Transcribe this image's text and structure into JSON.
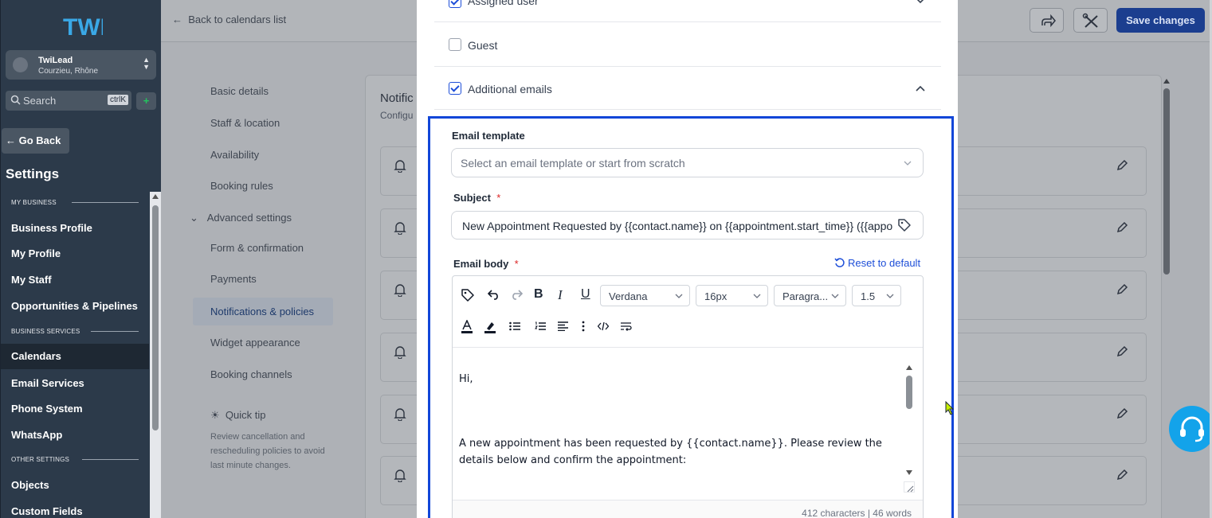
{
  "sidebar": {
    "logo_text": "TWI",
    "account": {
      "name": "TwiLead",
      "location": "Courzieu, Rhône"
    },
    "search": {
      "placeholder": "Search",
      "shortcut": "ctrlK"
    },
    "go_back": "Go Back",
    "title": "Settings",
    "sections": {
      "my_business": "MY BUSINESS",
      "business_services": "BUSINESS SERVICES",
      "other_settings": "OTHER SETTINGS"
    },
    "items": {
      "business_profile": "Business Profile",
      "my_profile": "My Profile",
      "my_staff": "My Staff",
      "opportunities": "Opportunities & Pipelines",
      "calendars": "Calendars",
      "email_services": "Email Services",
      "phone_system": "Phone System",
      "whatsapp": "WhatsApp",
      "objects": "Objects",
      "custom_fields": "Custom Fields"
    }
  },
  "topbar": {
    "back": "Back to calendars list",
    "save": "Save changes"
  },
  "subnav": {
    "basic": "Basic details",
    "staff": "Staff & location",
    "availability": "Availability",
    "booking_rules": "Booking rules",
    "advanced": "Advanced settings",
    "form": "Form & confirmation",
    "payments": "Payments",
    "notifications": "Notifications & policies",
    "widget": "Widget appearance",
    "channels": "Booking channels"
  },
  "quick_tip": {
    "title": "Quick tip",
    "text": "Review cancellation and rescheduling policies to avoid last minute changes."
  },
  "panel": {
    "title": "Notific",
    "subtitle": "Configu"
  },
  "modal": {
    "recipients": {
      "assigned_user": "Assigned user",
      "guest": "Guest",
      "additional_emails": "Additional emails"
    },
    "email_template": {
      "label": "Email template",
      "placeholder": "Select an email template or start from scratch"
    },
    "subject": {
      "label": "Subject",
      "required": "*",
      "value": "New Appointment Requested by {{contact.name}} on {{appointment.start_time}} ({{appoint"
    },
    "email_body": {
      "label": "Email body",
      "required": "*",
      "reset": "Reset to default"
    },
    "toolbar": {
      "font": "Verdana",
      "size": "16px",
      "format": "Paragra...",
      "line_height": "1.5"
    },
    "body": {
      "line1": "Hi,",
      "line2": "A new appointment has been requested by {{contact.name}}. Please review the details below and confirm the appointment:"
    },
    "counter": "412 characters | 46 words"
  },
  "colors": {
    "accent": "#1d4ed8",
    "highlight": "#1246d8",
    "sidebar": "#2c3a4a",
    "help": "#13a3ea"
  }
}
